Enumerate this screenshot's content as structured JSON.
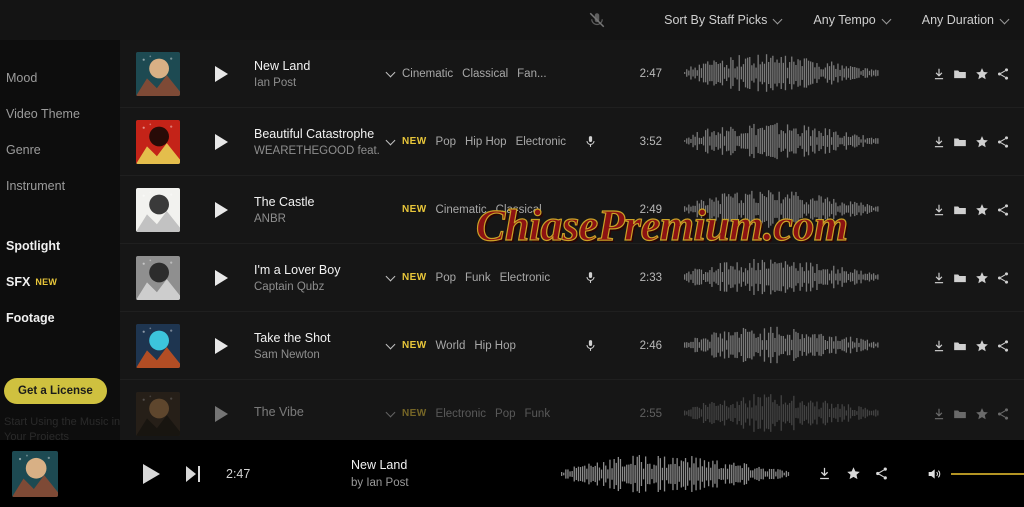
{
  "topbar": {
    "mic_icon": "mic-muted-icon",
    "filters": [
      {
        "label": "Sort By Staff Picks"
      },
      {
        "label": "Any Tempo"
      },
      {
        "label": "Any Duration"
      }
    ]
  },
  "sidebar": {
    "items": [
      {
        "label": "Mood",
        "bold": false
      },
      {
        "label": "Video Theme",
        "bold": false
      },
      {
        "label": "Genre",
        "bold": false
      },
      {
        "label": "Instrument",
        "bold": false
      }
    ],
    "items2": [
      {
        "label": "Spotlight",
        "bold": true,
        "badge": ""
      },
      {
        "label": "SFX",
        "bold": true,
        "badge": "NEW"
      },
      {
        "label": "Footage",
        "bold": true,
        "badge": ""
      }
    ],
    "license_button": "Get a License",
    "license_sub": "Start Using the Music in Your Projects"
  },
  "tracks": [
    {
      "title": "New Land",
      "artist": "Ian Post",
      "new": "",
      "tags": "Cinematic   Classical   Fan...",
      "vocal": false,
      "expander": true,
      "duration": "2:47",
      "art": {
        "bg": "#1d4a52",
        "fg": "#e8b98a",
        "accent": "#8a4a33"
      }
    },
    {
      "title": "Beautiful Catastrophe",
      "artist": "WEARETHEGOOD feat. Frank Bentley",
      "new": "NEW",
      "tags": "Pop   Hip Hop   Electronic",
      "vocal": true,
      "expander": true,
      "duration": "3:52",
      "art": {
        "bg": "#c42318",
        "fg": "#1a0a06",
        "accent": "#e8cf52"
      }
    },
    {
      "title": "The Castle",
      "artist": "ANBR",
      "new": "NEW",
      "tags": "Cinematic   Classical",
      "vocal": false,
      "expander": false,
      "duration": "2:49",
      "art": {
        "bg": "#f2f2ef",
        "fg": "#2a2a2a",
        "accent": "#bdbdbd"
      }
    },
    {
      "title": "I'm a Lover Boy",
      "artist": "Captain Qubz",
      "new": "NEW",
      "tags": "Pop   Funk   Electronic",
      "vocal": true,
      "expander": true,
      "duration": "2:33",
      "art": {
        "bg": "#8f8f8f",
        "fg": "#242424",
        "accent": "#d4d4d4"
      }
    },
    {
      "title": "Take the Shot",
      "artist": "Sam Newton",
      "new": "NEW",
      "tags": "World   Hip Hop",
      "vocal": true,
      "expander": true,
      "duration": "2:46",
      "art": {
        "bg": "#1e3550",
        "fg": "#3fd0e8",
        "accent": "#c2501f"
      }
    },
    {
      "title": "The Vibe",
      "artist": "",
      "new": "NEW",
      "tags": "Electronic   Pop   Funk",
      "vocal": false,
      "expander": true,
      "duration": "2:55",
      "art": {
        "bg": "#3a2a1c",
        "fg": "#c08a4e",
        "accent": "#1a1208"
      }
    }
  ],
  "watermark": {
    "text": "ChiasePremium.com",
    "color": "#8c1212",
    "outline": "#c9a227"
  },
  "player": {
    "time": "2:47",
    "title": "New Land",
    "artist": "by Ian Post",
    "play_icon": "play-icon",
    "next_icon": "next-track-icon",
    "download_icon": "download-icon",
    "star_icon": "star-icon",
    "share_icon": "share-icon",
    "volume_icon": "volume-icon",
    "volume_value": 92,
    "accent": "#b39424"
  },
  "row_icons": {
    "download": "download-icon",
    "folder": "folder-icon",
    "star": "star-icon",
    "share": "share-icon",
    "vocal": "microphone-icon"
  }
}
